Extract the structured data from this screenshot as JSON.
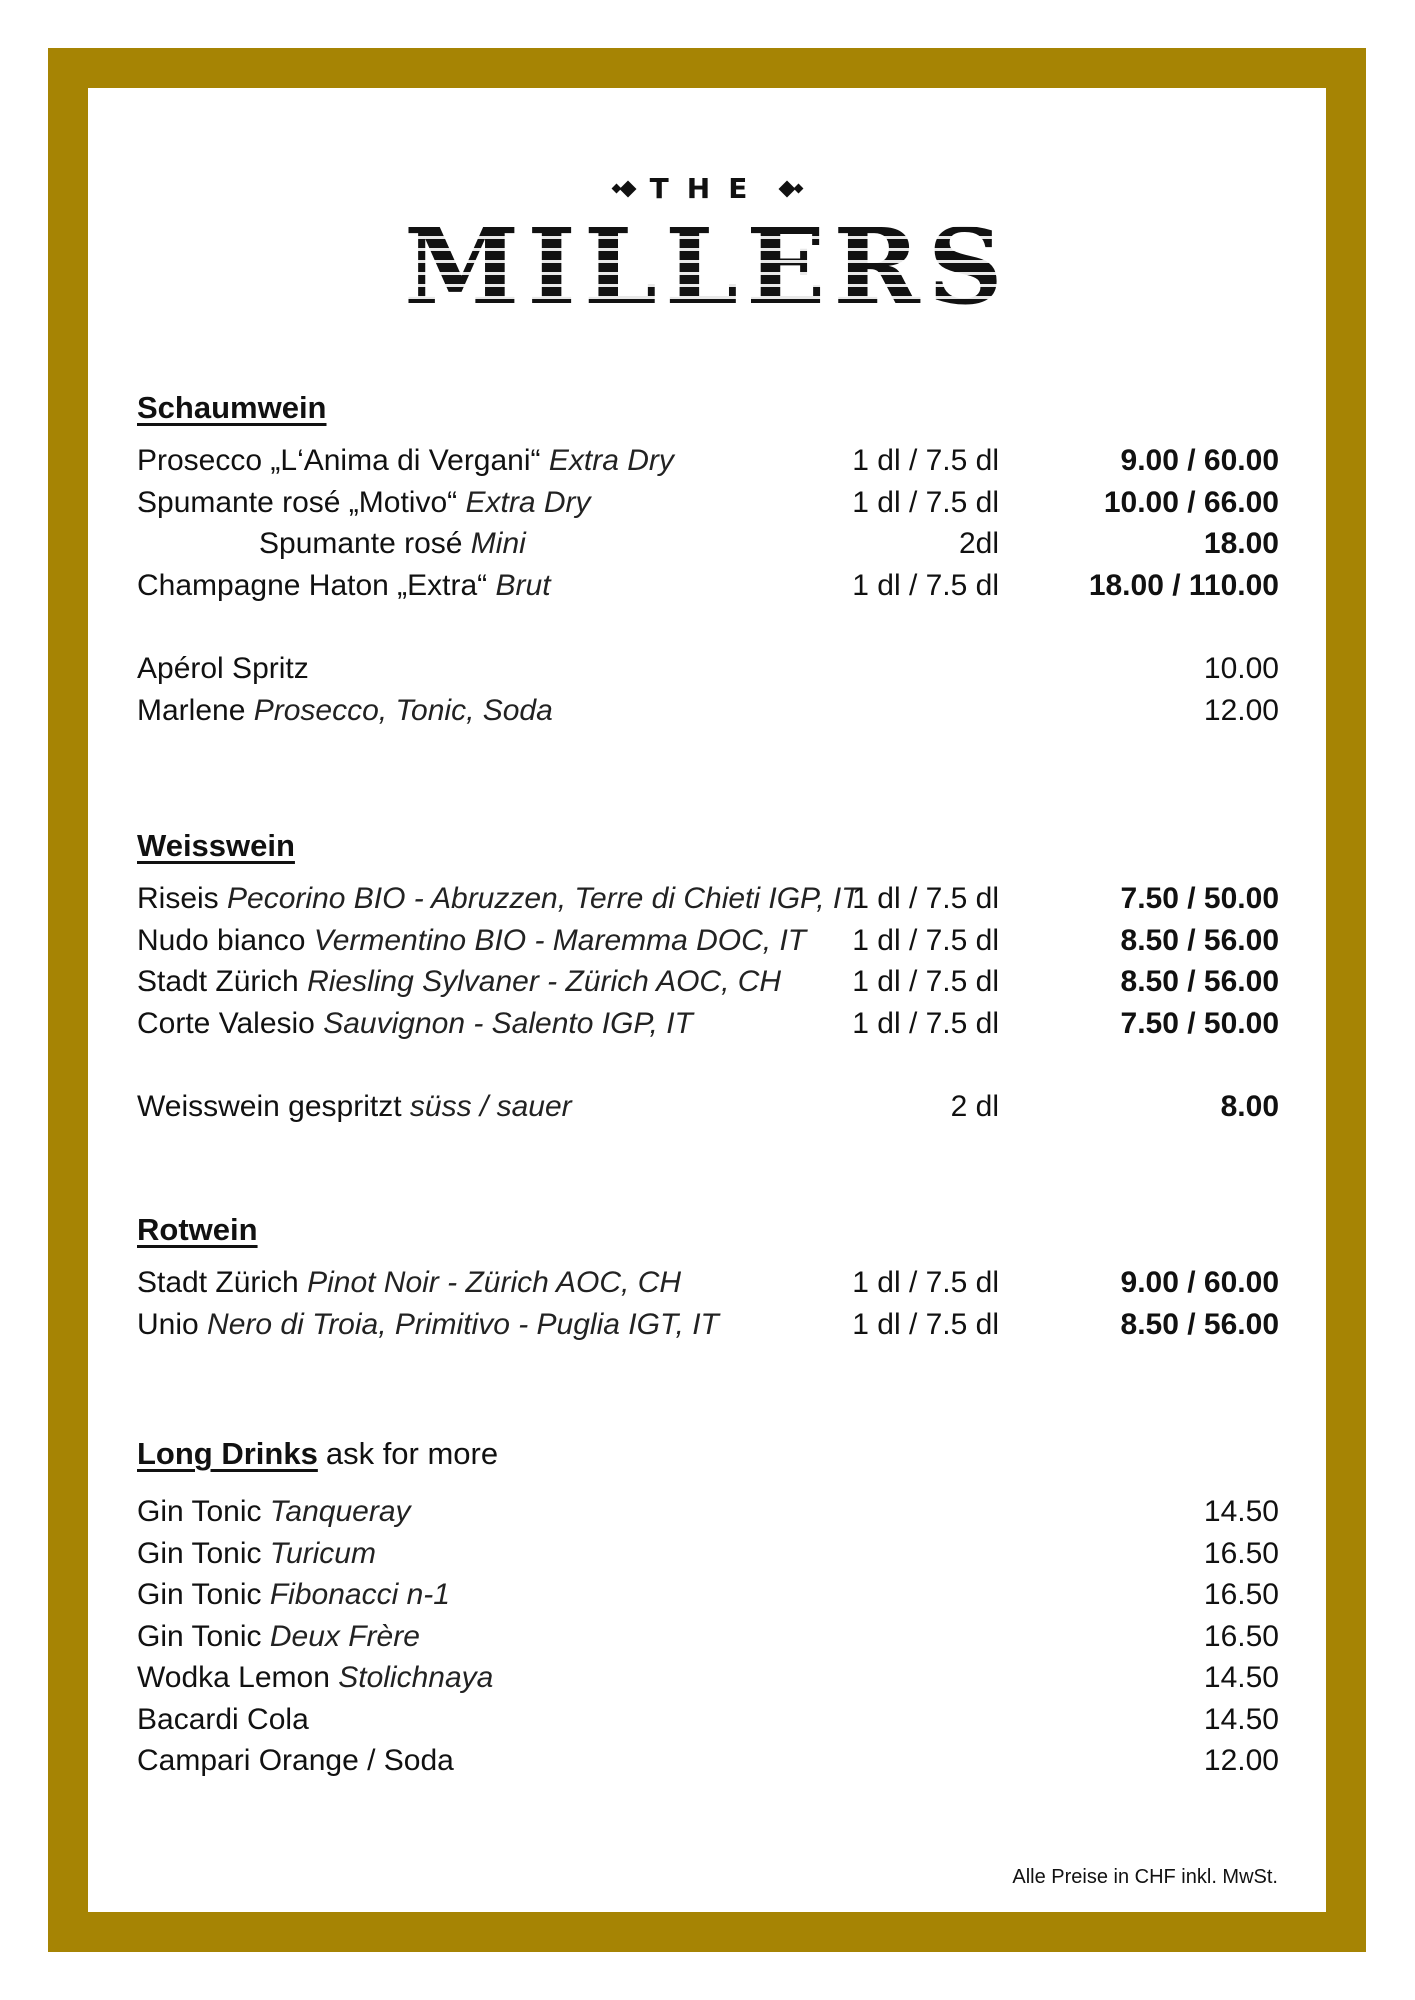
{
  "brand": {
    "top": "THE",
    "main": "MILLERS"
  },
  "sections": [
    {
      "title": "Schaumwein",
      "suffix": "",
      "rows": [
        {
          "name": "Prosecco „L‘Anima di Vergani“",
          "detail": "Extra Dry",
          "size": "1 dl / 7.5 dl",
          "price": "9.00 / 60.00",
          "indent": false
        },
        {
          "name": "Spumante rosé „Motivo“",
          "detail": "Extra Dry",
          "size": "1 dl / 7.5 dl",
          "price": "10.00 / 66.00",
          "indent": false
        },
        {
          "name": "Spumante rosé",
          "detail": "Mini",
          "size": "2dl",
          "price": "18.00",
          "indent": true
        },
        {
          "name": "Champagne Haton „Extra“",
          "detail": "Brut",
          "size": "1 dl / 7.5 dl",
          "price": "18.00 / 110.00",
          "indent": false
        },
        {
          "gap": true
        },
        {
          "name": "Apérol Spritz",
          "detail": "",
          "size": "",
          "price": "10.00",
          "indent": false
        },
        {
          "name": "Marlene",
          "detail": "Prosecco, Tonic, Soda",
          "size": "",
          "price": "12.00",
          "indent": false
        }
      ]
    },
    {
      "title": "Weisswein",
      "suffix": "",
      "rows": [
        {
          "name": "Riseis",
          "detail": "Pecorino BIO - Abruzzen, Terre di Chieti IGP, IT",
          "size": "1 dl / 7.5 dl",
          "price": "7.50 / 50.00",
          "indent": false
        },
        {
          "name": "Nudo bianco",
          "detail": "Vermentino BIO - Maremma DOC, IT",
          "size": "1 dl / 7.5 dl",
          "price": "8.50 / 56.00",
          "indent": false
        },
        {
          "name": "Stadt Zürich",
          "detail": "Riesling Sylvaner - Zürich AOC, CH",
          "size": "1 dl / 7.5 dl",
          "price": "8.50 / 56.00",
          "indent": false
        },
        {
          "name": "Corte Valesio",
          "detail": "Sauvignon - Salento IGP, IT",
          "size": "1 dl / 7.5 dl",
          "price": "7.50 / 50.00",
          "indent": false
        },
        {
          "gap": true
        },
        {
          "name": "Weisswein gespritzt",
          "detail": "süss / sauer",
          "size": "2 dl",
          "price": "8.00",
          "indent": false
        }
      ]
    },
    {
      "title": "Rotwein",
      "suffix": "",
      "rows": [
        {
          "name": "Stadt Zürich",
          "detail": "Pinot Noir - Zürich AOC, CH",
          "size": "1 dl / 7.5 dl",
          "price": "9.00 / 60.00",
          "indent": false
        },
        {
          "name": "Unio",
          "detail": "Nero di Troia, Primitivo - Puglia IGT, IT",
          "size": "1 dl / 7.5 dl",
          "price": "8.50 / 56.00",
          "indent": false
        }
      ]
    },
    {
      "title": "Long Drinks",
      "suffix": "ask for more",
      "rows": [
        {
          "name": "Gin Tonic",
          "detail": "Tanqueray",
          "size": "",
          "price": "14.50",
          "indent": false
        },
        {
          "name": "Gin Tonic",
          "detail": "Turicum",
          "size": "",
          "price": "16.50",
          "indent": false
        },
        {
          "name": "Gin Tonic",
          "detail": "Fibonacci n-1",
          "size": "",
          "price": "16.50",
          "indent": false
        },
        {
          "name": "Gin Tonic",
          "detail": "Deux Frère",
          "size": "",
          "price": "16.50",
          "indent": false
        },
        {
          "name": "Wodka Lemon",
          "detail": "Stolichnaya",
          "size": "",
          "price": "14.50",
          "indent": false
        },
        {
          "name": "Bacardi Cola",
          "detail": "",
          "size": "",
          "price": "14.50",
          "indent": false
        },
        {
          "name": "Campari Orange / Soda",
          "detail": "",
          "size": "",
          "price": "12.00",
          "indent": false
        }
      ]
    }
  ],
  "footer": "Alle Preise in CHF inkl. MwSt.",
  "colors": {
    "frame": "#a68404",
    "text": "#111111"
  }
}
